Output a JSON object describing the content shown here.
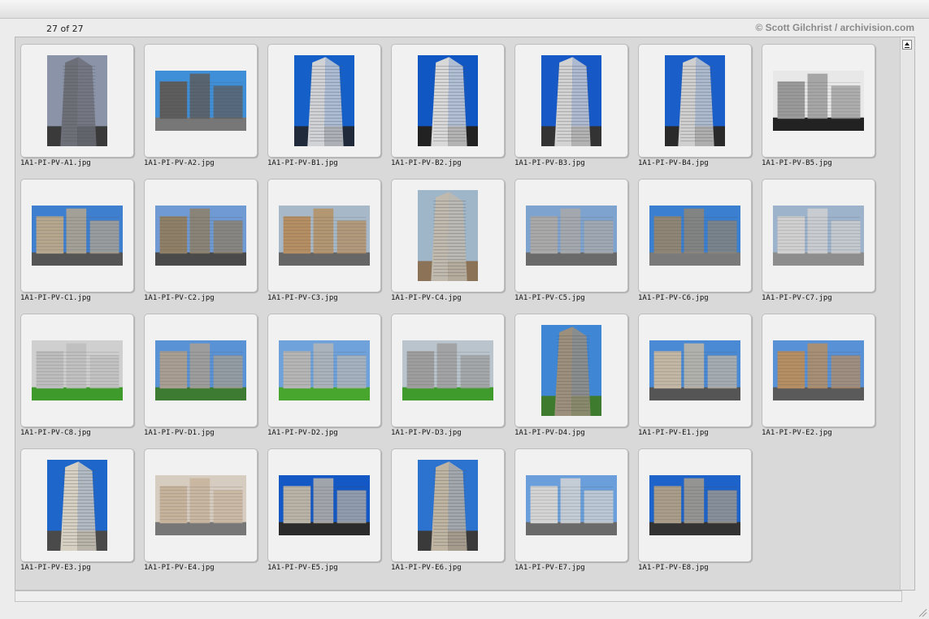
{
  "header": {
    "count": "27 of 27",
    "credit": "© Scott Gilchrist / archivision.com"
  },
  "thumbnails": [
    {
      "name": "1A1-PI-PV-A1.jpg",
      "orientation": "portrait",
      "sky": "#8a93a8",
      "ground": "#3a3a3a",
      "building": "#6d6f78"
    },
    {
      "name": "1A1-PI-PV-A2.jpg",
      "orientation": "landscape",
      "sky": "#3f8fd8",
      "ground": "#777777",
      "building": "#5d5d5d"
    },
    {
      "name": "1A1-PI-PV-B1.jpg",
      "orientation": "portrait",
      "sky": "#1560c8",
      "ground": "#202a3a",
      "building": "#d0d2d6"
    },
    {
      "name": "1A1-PI-PV-B2.jpg",
      "orientation": "portrait",
      "sky": "#1157c4",
      "ground": "#222222",
      "building": "#d8d8d8"
    },
    {
      "name": "1A1-PI-PV-B3.jpg",
      "orientation": "portrait",
      "sky": "#1558c6",
      "ground": "#333333",
      "building": "#d2d2d2"
    },
    {
      "name": "1A1-PI-PV-B4.jpg",
      "orientation": "portrait",
      "sky": "#1a5fc9",
      "ground": "#2a2a2a",
      "building": "#cfcfcf"
    },
    {
      "name": "1A1-PI-PV-B5.jpg",
      "orientation": "landscape",
      "sky": "#e8e8e8",
      "ground": "#222222",
      "building": "#9a9a9a"
    },
    {
      "name": "1A1-PI-PV-C1.jpg",
      "orientation": "landscape",
      "sky": "#3f7fd0",
      "ground": "#555555",
      "building": "#b5a68e"
    },
    {
      "name": "1A1-PI-PV-C2.jpg",
      "orientation": "landscape",
      "sky": "#6f9ad4",
      "ground": "#4a4a4a",
      "building": "#8f7f66"
    },
    {
      "name": "1A1-PI-PV-C3.jpg",
      "orientation": "landscape",
      "sky": "#a7b8c8",
      "ground": "#666666",
      "building": "#b58f63"
    },
    {
      "name": "1A1-PI-PV-C4.jpg",
      "orientation": "portrait",
      "sky": "#9fb5c8",
      "ground": "#8c7357",
      "building": "#bfb9ae"
    },
    {
      "name": "1A1-PI-PV-C5.jpg",
      "orientation": "landscape",
      "sky": "#7fa3cf",
      "ground": "#6a6a6a",
      "building": "#a9a9a9"
    },
    {
      "name": "1A1-PI-PV-C6.jpg",
      "orientation": "landscape",
      "sky": "#3b7fd0",
      "ground": "#7a7a7a",
      "building": "#8f8577"
    },
    {
      "name": "1A1-PI-PV-C7.jpg",
      "orientation": "landscape",
      "sky": "#9db3cc",
      "ground": "#8d8d8d",
      "building": "#d0d0d0"
    },
    {
      "name": "1A1-PI-PV-C8.jpg",
      "orientation": "landscape",
      "sky": "#cfcfcf",
      "ground": "#3e9a2a",
      "building": "#bdbdbd"
    },
    {
      "name": "1A1-PI-PV-D1.jpg",
      "orientation": "landscape",
      "sky": "#5a92d6",
      "ground": "#3d7a32",
      "building": "#a89f92"
    },
    {
      "name": "1A1-PI-PV-D2.jpg",
      "orientation": "landscape",
      "sky": "#6fa2db",
      "ground": "#48a52e",
      "building": "#b5b5b5"
    },
    {
      "name": "1A1-PI-PV-D3.jpg",
      "orientation": "landscape",
      "sky": "#b9c4cc",
      "ground": "#3f9b2c",
      "building": "#9e9e9e"
    },
    {
      "name": "1A1-PI-PV-D4.jpg",
      "orientation": "portrait",
      "sky": "#3f86d4",
      "ground": "#3e7b2f",
      "building": "#9c8f7c"
    },
    {
      "name": "1A1-PI-PV-E1.jpg",
      "orientation": "landscape",
      "sky": "#4a8ad5",
      "ground": "#555555",
      "building": "#c2b7a5"
    },
    {
      "name": "1A1-PI-PV-E2.jpg",
      "orientation": "landscape",
      "sky": "#5891d6",
      "ground": "#5a5a5a",
      "building": "#b58e64"
    },
    {
      "name": "1A1-PI-PV-E3.jpg",
      "orientation": "portrait",
      "sky": "#1e66c9",
      "ground": "#4a4a4a",
      "building": "#d6d0c2"
    },
    {
      "name": "1A1-PI-PV-E4.jpg",
      "orientation": "landscape",
      "sky": "#d6ccbf",
      "ground": "#777777",
      "building": "#c7b39c"
    },
    {
      "name": "1A1-PI-PV-E5.jpg",
      "orientation": "landscape",
      "sky": "#1458c5",
      "ground": "#2b2b2b",
      "building": "#b9b2a6"
    },
    {
      "name": "1A1-PI-PV-E6.jpg",
      "orientation": "portrait",
      "sky": "#2c73d0",
      "ground": "#3a3a3a",
      "building": "#bfb4a2"
    },
    {
      "name": "1A1-PI-PV-E7.jpg",
      "orientation": "landscape",
      "sky": "#6a9fdb",
      "ground": "#6a6a6a",
      "building": "#d4d4d4"
    },
    {
      "name": "1A1-PI-PV-E8.jpg",
      "orientation": "landscape",
      "sky": "#1d63c9",
      "ground": "#333333",
      "building": "#a99d8a"
    }
  ]
}
